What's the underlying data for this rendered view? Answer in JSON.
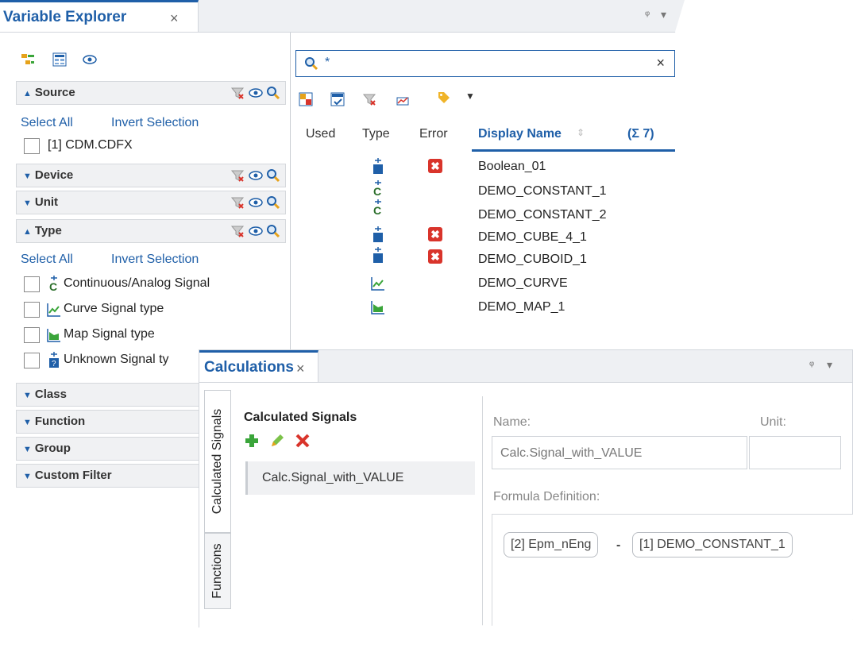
{
  "variable_explorer": {
    "title": "Variable Explorer",
    "close": "×",
    "pin": "ᵠ",
    "menu": "▾",
    "search": {
      "value": "*",
      "clear": "×"
    },
    "sections": [
      {
        "label": "Source",
        "expanded": true
      },
      {
        "label": "Device",
        "expanded": false
      },
      {
        "label": "Unit",
        "expanded": false
      },
      {
        "label": "Type",
        "expanded": true
      },
      {
        "label": "Class",
        "expanded": false
      },
      {
        "label": "Function",
        "expanded": false
      },
      {
        "label": "Group",
        "expanded": false
      },
      {
        "label": "Custom Filter",
        "expanded": false
      }
    ],
    "select_all": "Select All",
    "invert_selection": "Invert Selection",
    "source_items": [
      "[1] CDM.CDFX"
    ],
    "type_items": [
      "Continuous/Analog Signal",
      "Curve Signal type",
      "Map Signal type",
      "Unknown Signal ty"
    ],
    "columns": {
      "used": "Used",
      "type": "Type",
      "error": "Error",
      "display_name": "Display Name",
      "count": "(Σ 7)"
    },
    "rows": [
      {
        "name": "Boolean_01",
        "type": "unknown",
        "error": true
      },
      {
        "name": "DEMO_CONSTANT_1",
        "type": "continuous",
        "error": false
      },
      {
        "name": "DEMO_CONSTANT_2",
        "type": "continuous",
        "error": false
      },
      {
        "name": "DEMO_CUBE_4_1",
        "type": "unknown",
        "error": true
      },
      {
        "name": "DEMO_CUBOID_1",
        "type": "unknown",
        "error": true
      },
      {
        "name": "DEMO_CURVE",
        "type": "curve",
        "error": false
      },
      {
        "name": "DEMO_MAP_1",
        "type": "map",
        "error": false
      }
    ]
  },
  "calculations": {
    "title": "Calculations",
    "close": "×",
    "vertical_tabs": [
      "Calculated Signals",
      "Functions"
    ],
    "list_title": "Calculated Signals",
    "signals": [
      "Calc.Signal_with_VALUE"
    ],
    "name_label": "Name:",
    "unit_label": "Unit:",
    "name_value": "Calc.Signal_with_VALUE",
    "formula_label": "Formula Definition:",
    "formula": {
      "left": "[2] Epm_nEng",
      "operator": "-",
      "right": "[1] DEMO_CONSTANT_1"
    }
  },
  "colors": {
    "accent": "#1f5fa8",
    "error": "#d9342b",
    "green": "#3aa53a"
  }
}
